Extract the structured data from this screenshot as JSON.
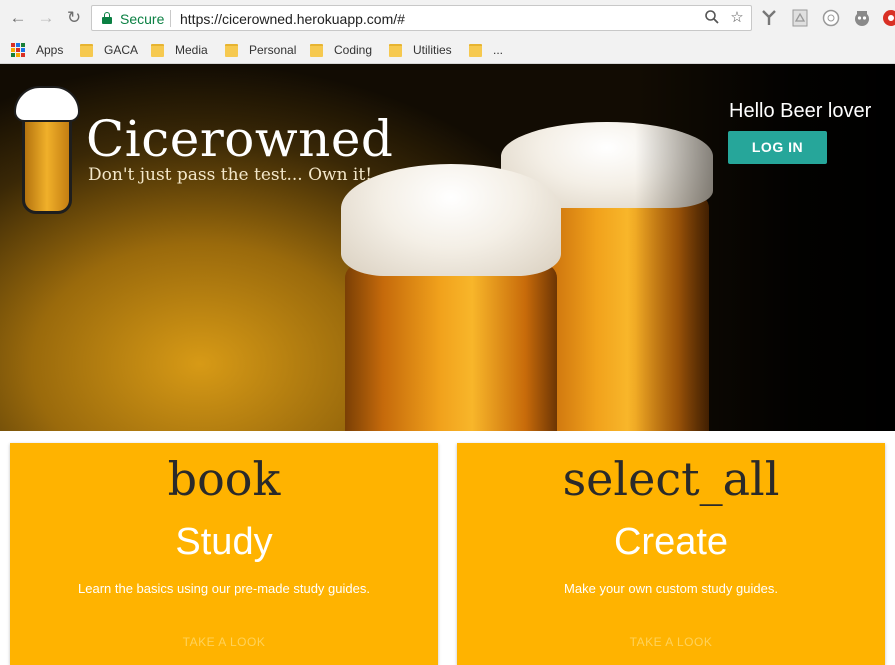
{
  "browser": {
    "secure_label": "Secure",
    "url": "https://cicerowned.herokuapp.com/#",
    "icons": [
      "back-arrow-icon",
      "forward-arrow-icon",
      "reload-icon",
      "zoom-icon",
      "star-icon"
    ],
    "bookmarks": [
      {
        "label": "Apps",
        "icon": "apps-grid-icon"
      },
      {
        "label": "GACA",
        "icon": "folder-icon"
      },
      {
        "label": "Media",
        "icon": "folder-icon"
      },
      {
        "label": "Personal",
        "icon": "folder-icon"
      },
      {
        "label": "Coding",
        "icon": "folder-icon"
      },
      {
        "label": "Utilities",
        "icon": "folder-icon"
      },
      {
        "label": "...",
        "icon": "folder-icon"
      }
    ]
  },
  "hero": {
    "brand": "Cicerowned",
    "tagline": "Don't just pass the test... Own it!",
    "greeting": "Hello Beer lover",
    "login_label": "LOG IN"
  },
  "cards": [
    {
      "icon_text": "book",
      "title": "Study",
      "description": "Learn the basics using our pre-made study guides.",
      "faint_text": "TAKE A LOOK"
    },
    {
      "icon_text": "select_all",
      "title": "Create",
      "description": "Make your own custom study guides.",
      "faint_text": "TAKE A LOOK"
    }
  ],
  "colors": {
    "card": "#ffb300",
    "login_button": "#26a69a",
    "secure": "#0b8043"
  }
}
